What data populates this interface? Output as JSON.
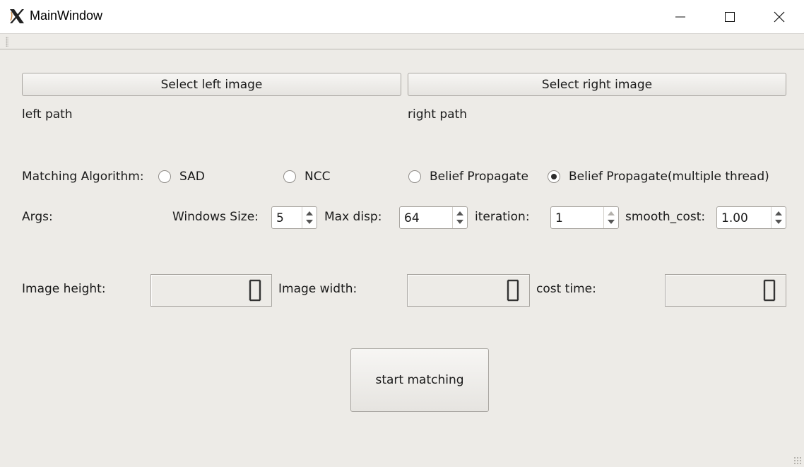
{
  "window": {
    "title": "MainWindow"
  },
  "buttons": {
    "select_left": "Select left image",
    "select_right": "Select right image",
    "start": "start matching"
  },
  "paths": {
    "left": "left path",
    "right": "right path"
  },
  "algorithm": {
    "label": "Matching Algorithm:",
    "options": [
      "SAD",
      "NCC",
      "Belief Propagate",
      "Belief Propagate(multiple thread)"
    ],
    "selected": "Belief Propagate(multiple thread)"
  },
  "args": {
    "label": "Args:",
    "window_size": {
      "label": "Windows Size:",
      "value": "5"
    },
    "max_disp": {
      "label": "Max disp:",
      "value": "64"
    },
    "iteration": {
      "label": "iteration:",
      "value": "1"
    },
    "smooth_cost": {
      "label": "smooth_cost:",
      "value": "1.00"
    }
  },
  "results": {
    "height": {
      "label": "Image height:",
      "value": "0"
    },
    "width": {
      "label": "Image width:",
      "value": "0"
    },
    "cost_time": {
      "label": "cost time:",
      "value": "0"
    }
  },
  "icons": {
    "app": "x-logo-icon",
    "minimize": "minimize-icon",
    "maximize": "maximize-icon",
    "close": "close-icon",
    "spin_up": "chevron-up-icon",
    "spin_down": "chevron-down-icon"
  }
}
